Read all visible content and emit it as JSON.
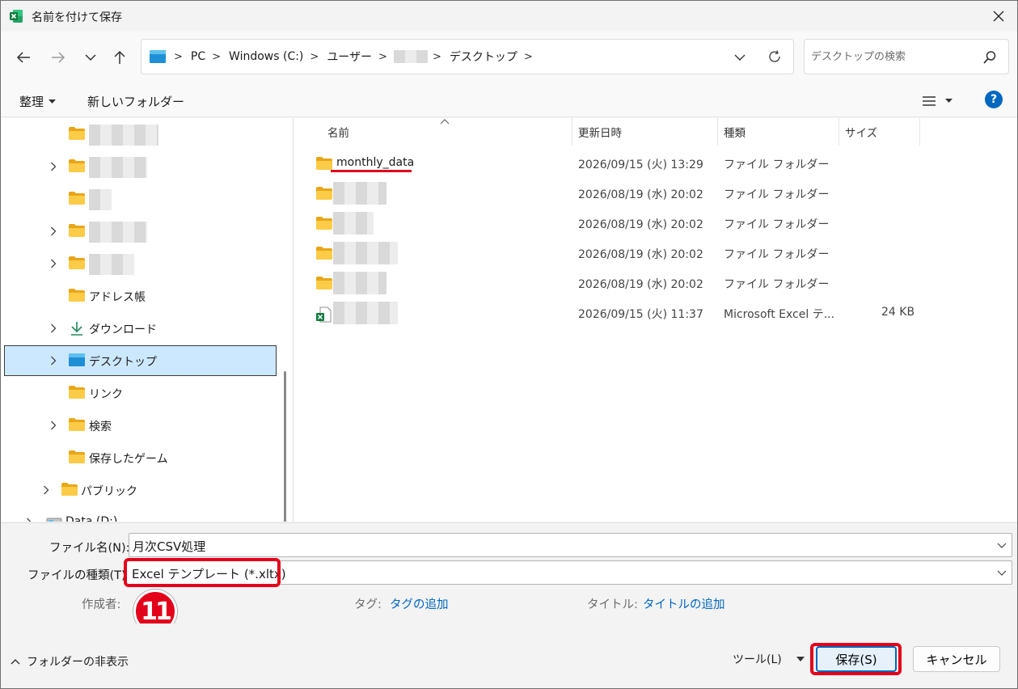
{
  "window": {
    "title": "名前を付けて保存"
  },
  "address": {
    "crumbs": [
      "PC",
      "Windows (C:)",
      "ユーザー",
      "",
      "デスクトップ"
    ]
  },
  "search": {
    "placeholder": "デスクトップの検索"
  },
  "commandbar": {
    "organize": "整理",
    "new_folder": "新しいフォルダー",
    "help": "?"
  },
  "nav_tree": {
    "items": [
      {
        "label": "",
        "expandable": false,
        "icon": "folder-icon",
        "blurred": true
      },
      {
        "label": "",
        "expandable": true,
        "icon": "folder-icon",
        "blurred": true
      },
      {
        "label": "",
        "expandable": false,
        "icon": "folder-icon",
        "blurred": true
      },
      {
        "label": "",
        "expandable": true,
        "icon": "folder-icon",
        "blurred": true
      },
      {
        "label": "",
        "expandable": true,
        "icon": "folder-icon",
        "blurred": true
      },
      {
        "label": "アドレス帳",
        "expandable": false,
        "icon": "folder-icon"
      },
      {
        "label": "ダウンロード",
        "expandable": true,
        "icon": "download-icon"
      },
      {
        "label": "デスクトップ",
        "expandable": true,
        "icon": "desktop-icon",
        "selected": true
      },
      {
        "label": "リンク",
        "expandable": false,
        "icon": "folder-icon"
      },
      {
        "label": "検索",
        "expandable": true,
        "icon": "folder-icon"
      },
      {
        "label": "保存したゲーム",
        "expandable": false,
        "icon": "folder-icon"
      },
      {
        "label": "パブリック",
        "expandable": true,
        "icon": "folder-icon"
      },
      {
        "label": "Data (D:)",
        "expandable": true,
        "icon": "drive-icon"
      }
    ]
  },
  "file_list": {
    "columns": [
      "名前",
      "更新日時",
      "種類",
      "サイズ"
    ],
    "rows": [
      {
        "name": "monthly_data",
        "date": "2026/09/15 (火) 13:29",
        "type": "ファイル フォルダー",
        "size": "",
        "icon": "folder-icon",
        "highlight": true
      },
      {
        "name": "",
        "date": "2026/08/19 (水) 20:02",
        "type": "ファイル フォルダー",
        "size": "",
        "icon": "folder-icon",
        "blurred": true
      },
      {
        "name": "",
        "date": "2026/08/19 (水) 20:02",
        "type": "ファイル フォルダー",
        "size": "",
        "icon": "folder-icon",
        "blurred": true
      },
      {
        "name": "",
        "date": "2026/08/19 (水) 20:02",
        "type": "ファイル フォルダー",
        "size": "",
        "icon": "folder-icon",
        "blurred": true
      },
      {
        "name": "",
        "date": "2026/08/19 (水) 20:02",
        "type": "ファイル フォルダー",
        "size": "",
        "icon": "folder-icon",
        "blurred": true
      },
      {
        "name": "",
        "date": "2026/09/15 (火) 11:37",
        "type": "Microsoft Excel テ...",
        "size": "24 KB",
        "icon": "excel-file-icon",
        "blurred": true
      }
    ]
  },
  "form": {
    "filename_label": "ファイル名(N):",
    "filename_value": "月次CSV処理",
    "filetype_label": "ファイルの種類(T):",
    "filetype_value": "Excel テンプレート (*.xltx)",
    "author_label": "作成者:",
    "tags_label": "タグ:",
    "tags_link": "タグの追加",
    "title_label": "タイトル:",
    "title_link": "タイトルの追加"
  },
  "annotation": {
    "step_number": "11"
  },
  "footer": {
    "hide_folders": "フォルダーの非表示",
    "tools": "ツール(L)",
    "save": "保存(S)",
    "cancel": "キャンセル"
  },
  "colors": {
    "accent": "#0067c0",
    "highlight_red": "#e3001b",
    "selection": "#cce8ff",
    "folder": "#f8c543"
  }
}
